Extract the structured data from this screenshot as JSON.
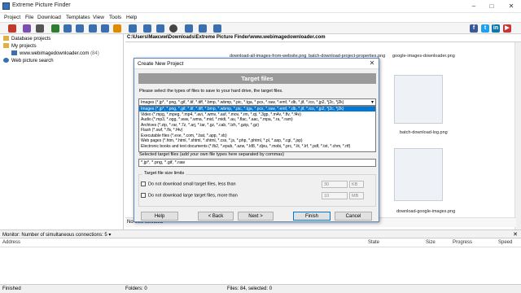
{
  "window": {
    "title": "Extreme Picture Finder"
  },
  "menu": [
    "Project",
    "File",
    "Download",
    "Templates",
    "View",
    "Tools",
    "Help"
  ],
  "tree": {
    "database_projects": "Database projects",
    "my_projects": "My projects",
    "site": "www.webimagedownloader.com",
    "site_count": "(84)",
    "web_search": "Web picture search"
  },
  "path": "C:\\Users\\Максим\\Downloads\\Extreme Picture Finder\\www.webimagedownloader.com",
  "gallery": {
    "captions_top": [
      "download-all-images-from-website.png",
      "batch-download-project-properties.png",
      "google-images-downloader.png"
    ],
    "caption_mid": "batch-download-log.png",
    "caption_bottom": "download-google-images.png"
  },
  "nofiles": "No files selected",
  "monitor": {
    "label": "Monitor",
    "connections_label": "Number of simultaneous connections:",
    "connections_value": "5"
  },
  "download_columns": [
    "Address",
    "State",
    "Size",
    "Progress",
    "Speed"
  ],
  "status": {
    "left": "Finished",
    "folders": "Folders: 0",
    "files": "Files: 84, selected: 0"
  },
  "dialog": {
    "title": "Create New Project",
    "banner": "Target files",
    "instruction": "Please select the types of files to save to your hard drive, the target files.",
    "selected_type": "Images (*.jp*, *.png, *.gif, *.tif, *.tiff, *.bmp, *.wbmp, *.pic, *.tga, *.pcx, *.raw, *.emf, *.db, *.jif, *.ico, *.jp2, *j2c, *j2k)",
    "options": [
      "Images (*.jp*, *.png, *.gif, *.tif, *.tiff, *.bmp, *.wbmp, *.pic, *.tga, *.pcx, *.raw, *.emf, *.db, *.jif, *.ico, *.jp2, *j2c, *j2k)",
      "Video (*.mpg, *.mpeg, *.mp4, *.avi, *.wmv, *.asf, *.mov, *.rm, *.qt, *.3gp, *.m4v, *.flv, *.f4v)",
      "Audio (*.mp3, *.ogg, *.wav, *.wma, *.mid, *.midi, *.au, *.flac, *.aac, *.mpa, *.ra, *.ram)",
      "Archives (*.zip, *.rar, *.7z, *.arj, *.tar, *.gz, *.cab, *.lzh, *.gzip, *.gz)",
      "Flash (*.swf, *.flv, *.f4v)",
      "Executable files (*.exe, *.com, *.bat, *.app, *.vb)",
      "Web pages (*.htm, *.html, *.shtml, *.xhtml, *.css, *.js, *.php, *.phtml, *.pl, *.asp, *.cgi, *.jsp)",
      "Electronic books and text documents (*.fb2, *.epub, *.azw, *.kf8, *.djvu, *.mobi, *.prc, *.lit, *.lrf, *.pdf, *.txt, *.chm, *.rtf)"
    ],
    "target_label": "Selected target files (add your own file types here separated by commas)",
    "target_value": "*.jp*, *.png, *.gif, *.raw",
    "size_group": "Target file size limits",
    "small_label": "Do not download small target files, less than",
    "small_value": "30",
    "small_unit": "KB",
    "large_label": "Do not download large target files, more than",
    "large_value": "10",
    "large_unit": "MB",
    "buttons": {
      "help": "Help",
      "back": "< Back",
      "next": "Next >",
      "finish": "Finish",
      "cancel": "Cancel"
    }
  },
  "colors": {
    "accent": "#0078d7",
    "banner": "#9a9a9a",
    "dialog_border": "#5a86c2"
  }
}
